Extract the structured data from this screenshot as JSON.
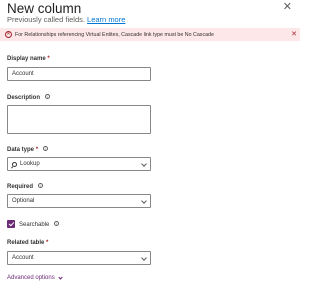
{
  "header": {
    "title": "New column",
    "subtitle_text": "Previously called fields.",
    "learn_more": "Learn more",
    "close_icon": "close-icon"
  },
  "error": {
    "message": "For Relationships referencing Virtual Entites, Cascade link type must be No Cascade",
    "icon": "error-circle-icon",
    "color": "#a4262c",
    "background": "#fde7e9"
  },
  "display_name": {
    "label": "Display name",
    "required_mark": "*",
    "value": "Account"
  },
  "description": {
    "label": "Description",
    "value": ""
  },
  "data_type": {
    "label": "Data type",
    "required_mark": "*",
    "value": "Lookup",
    "icon": "lookup-search-icon"
  },
  "required": {
    "label": "Required",
    "value": "Optional"
  },
  "searchable": {
    "label": "Searchable",
    "checked": true,
    "accent": "#6b2a75"
  },
  "related_table": {
    "label": "Related table",
    "required_mark": "*",
    "value": "Account"
  },
  "advanced": {
    "label": "Advanced options"
  }
}
